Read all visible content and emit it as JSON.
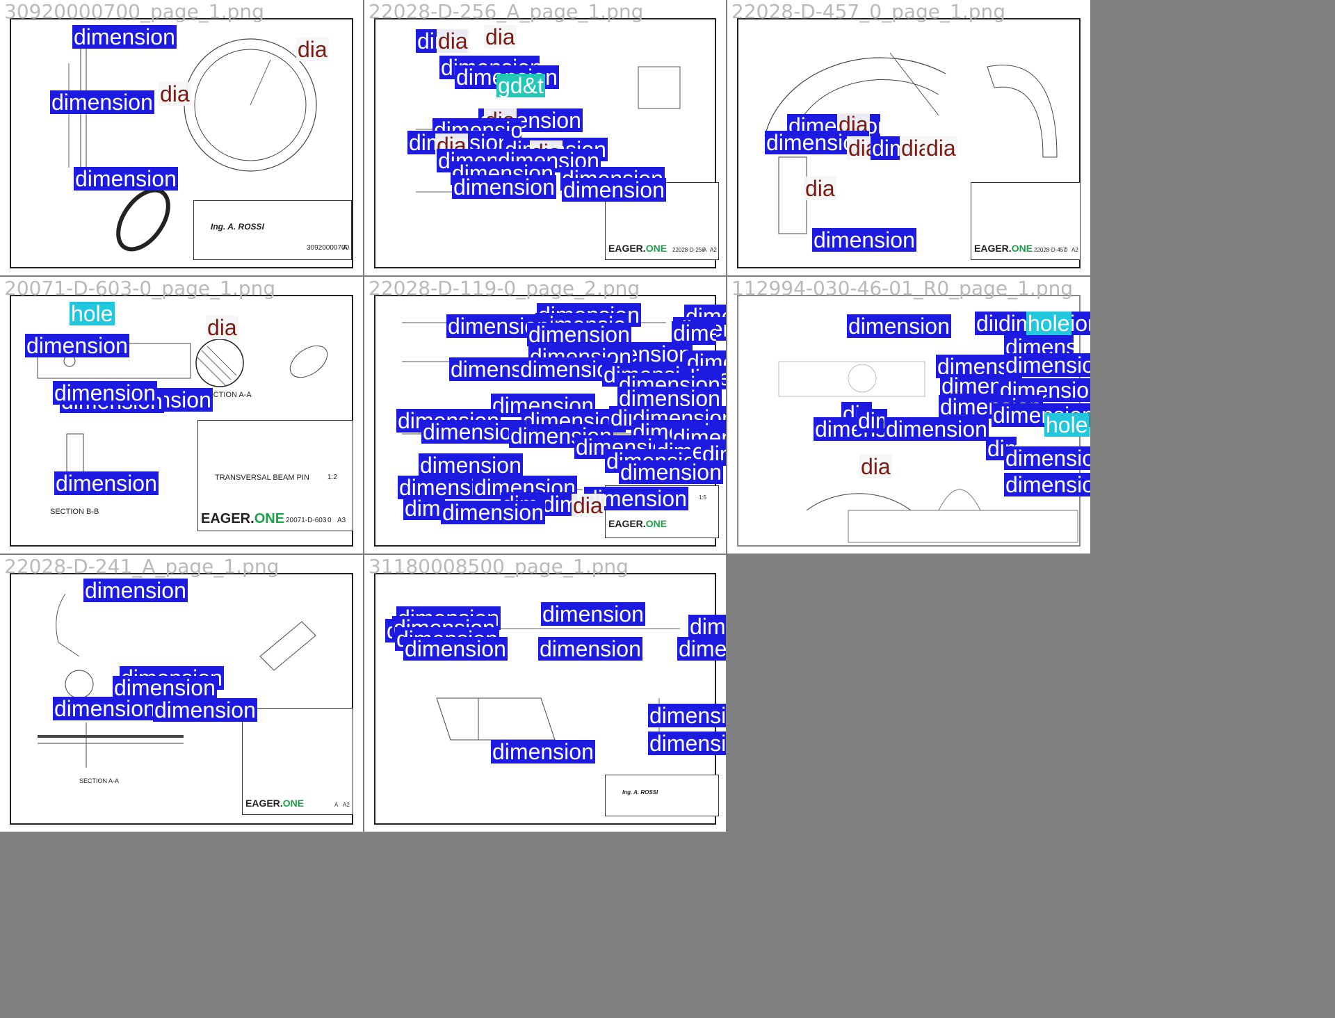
{
  "colors": {
    "background": "#808080",
    "dimension": "#1d1be0",
    "dia": "#7a1a10",
    "gdt": "#24c6b5",
    "hole": "#22c7dd"
  },
  "panels": [
    {
      "filename": "30920000700_page_1.png",
      "title_text": "Ing. A. ROSSI",
      "drawing_number": "30920000700",
      "revision": "A"
    },
    {
      "filename": "22028-D-256_A_page_1.png",
      "drawing_number": "22028-D-256",
      "revision": "A",
      "sheet_size": "A2",
      "logo": "EAGER.ONE"
    },
    {
      "filename": "22028-D-457_0_page_1.png",
      "drawing_number": "22028-D-457",
      "revision": "0",
      "sheet_size": "A2",
      "logo": "EAGER.ONE"
    },
    {
      "filename": "20071-D-603-0_page_1.png",
      "part_title": "TRANSVERSAL BEAM PIN",
      "scale": "1:2",
      "drawing_number": "20071-D-603",
      "revision": "0",
      "sheet_size": "A3",
      "logo": "EAGER.ONE",
      "section_a": "SECTION A-A",
      "section_b": "SECTION B-B"
    },
    {
      "filename": "22028-D-119-0_page_2.png",
      "logo": "EAGER.ONE",
      "scale": "1:5"
    },
    {
      "filename": "112994-030-46-01_R0_page_1.png"
    },
    {
      "filename": "22028-D-241_A_page_1.png",
      "logo": "EAGER.ONE",
      "section": "SECTION A-A",
      "revision": "A",
      "sheet_size": "A2"
    },
    {
      "filename": "31180008500_page_1.png",
      "title_text": "Ing. A. ROSSI"
    }
  ],
  "labels": {
    "dimension": "dimension",
    "dia": "dia",
    "gdt": "gd&t",
    "hole": "hole"
  }
}
